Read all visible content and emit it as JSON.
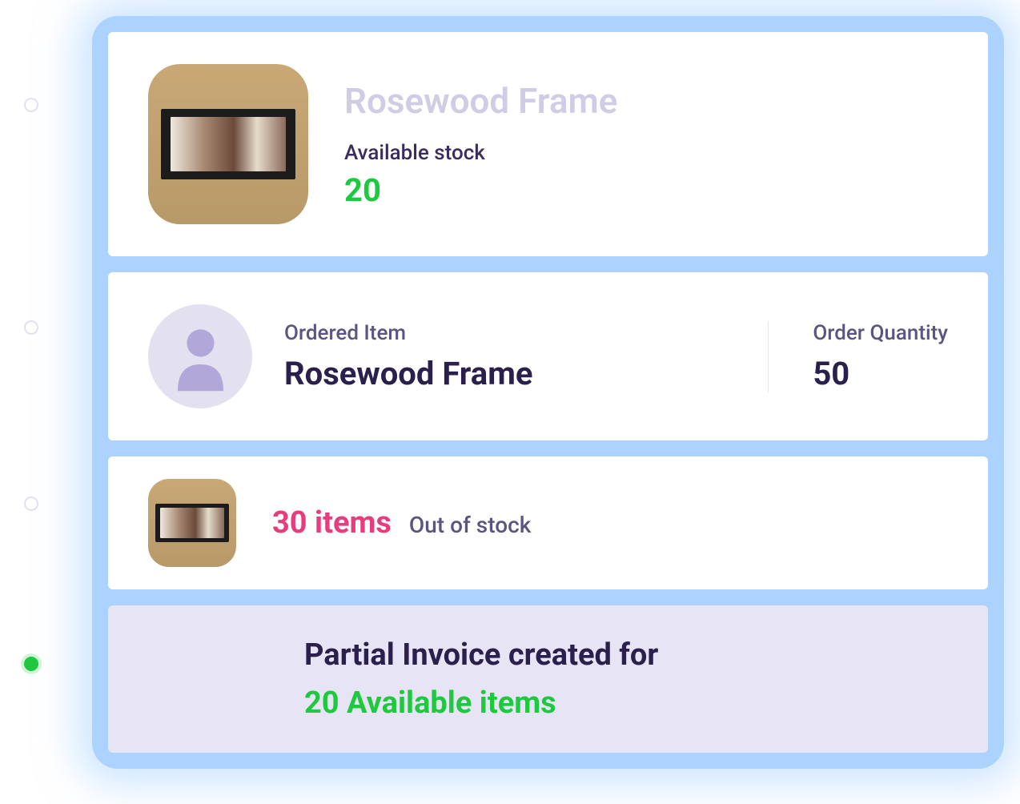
{
  "product": {
    "name": "Rosewood Frame",
    "stock_label": "Available stock",
    "stock_value": "20"
  },
  "order": {
    "item_label": "Ordered Item",
    "item_name": "Rosewood Frame",
    "quantity_label": "Order Quantity",
    "quantity_value": "50"
  },
  "shortage": {
    "count": "30 items",
    "status": "Out of stock"
  },
  "invoice": {
    "title": "Partial Invoice created for",
    "items": "20 Available items"
  }
}
